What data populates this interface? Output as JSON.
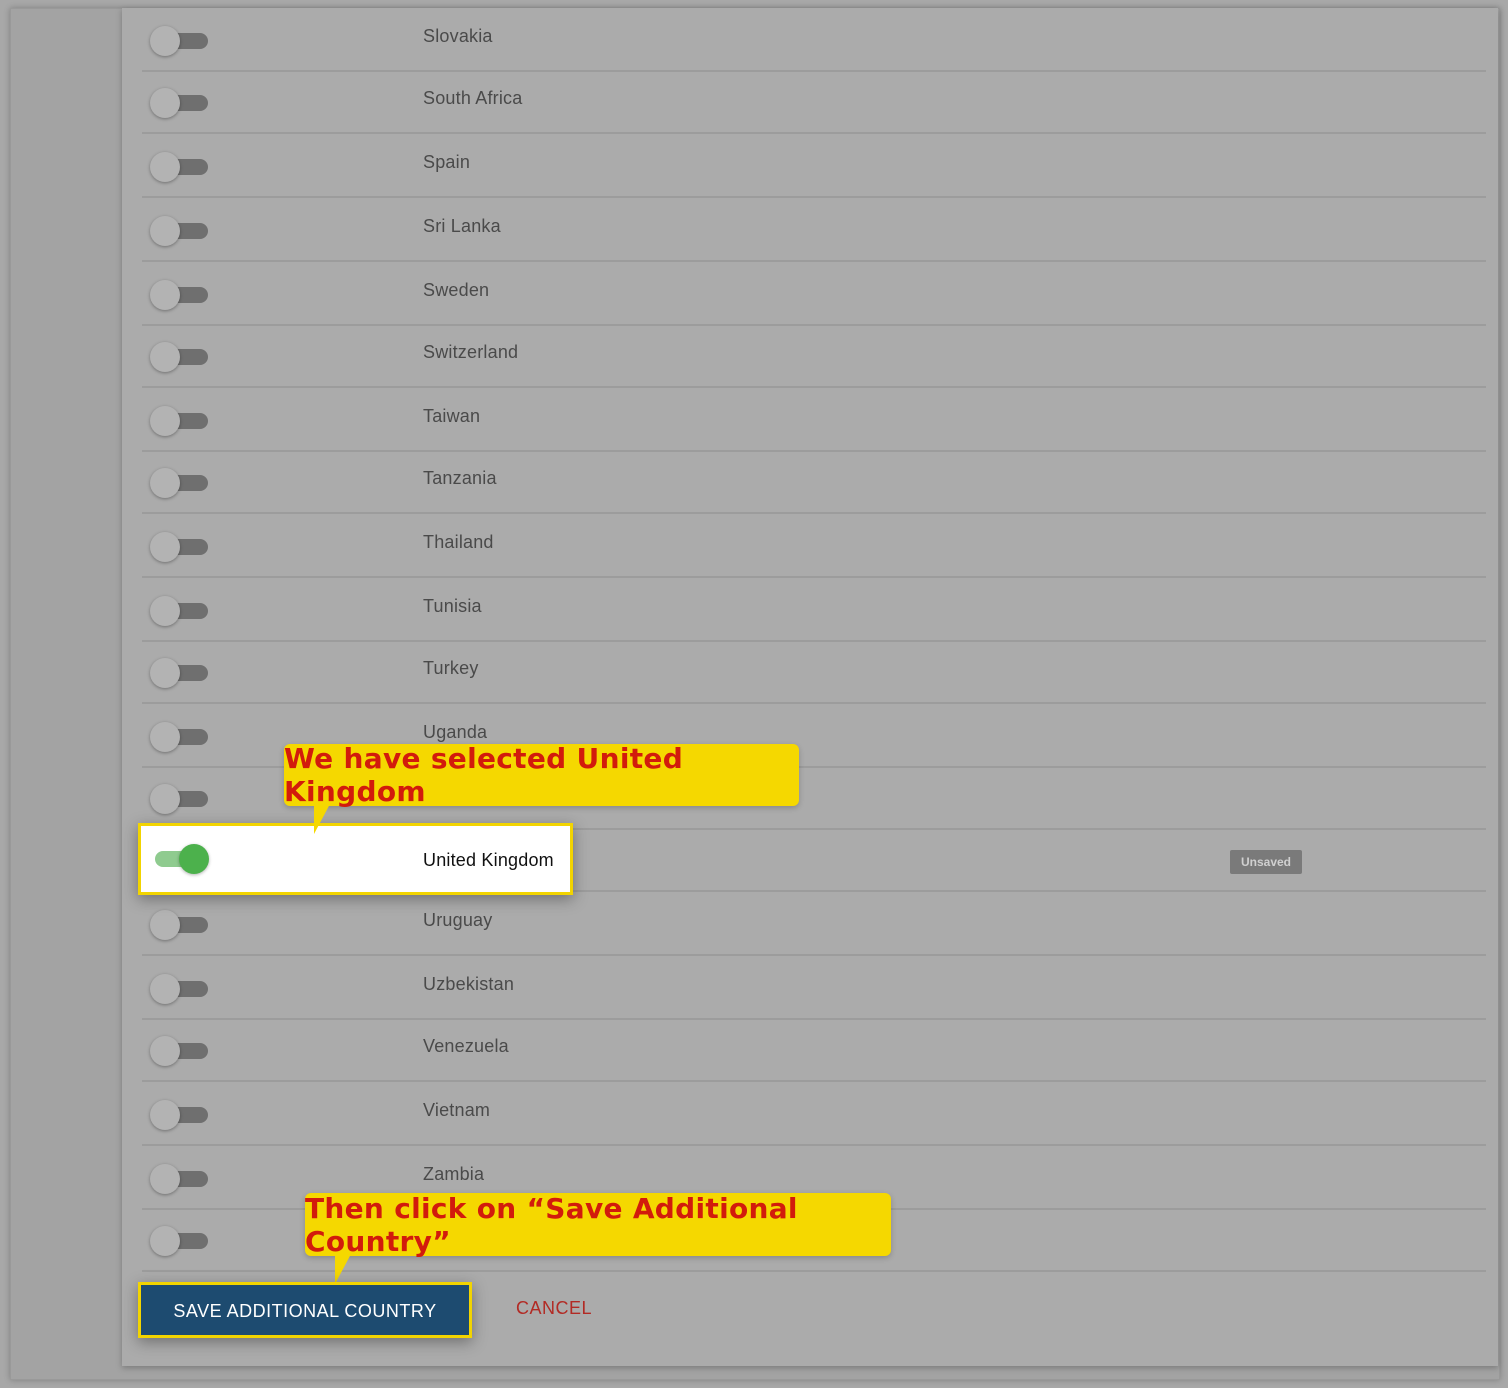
{
  "countries": [
    {
      "name": "Slovakia",
      "enabled": false
    },
    {
      "name": "South Africa",
      "enabled": false
    },
    {
      "name": "Spain",
      "enabled": false
    },
    {
      "name": "Sri Lanka",
      "enabled": false
    },
    {
      "name": "Sweden",
      "enabled": false
    },
    {
      "name": "Switzerland",
      "enabled": false
    },
    {
      "name": "Taiwan",
      "enabled": false
    },
    {
      "name": "Tanzania",
      "enabled": false
    },
    {
      "name": "Thailand",
      "enabled": false
    },
    {
      "name": "Tunisia",
      "enabled": false
    },
    {
      "name": "Turkey",
      "enabled": false
    },
    {
      "name": "Uganda",
      "enabled": false
    },
    {
      "name": "",
      "enabled": false
    },
    {
      "name": "United Kingdom",
      "enabled": true,
      "status": "Unsaved"
    },
    {
      "name": "Uruguay",
      "enabled": false
    },
    {
      "name": "Uzbekistan",
      "enabled": false
    },
    {
      "name": "Venezuela",
      "enabled": false
    },
    {
      "name": "Vietnam",
      "enabled": false
    },
    {
      "name": "Zambia",
      "enabled": false
    },
    {
      "name": "",
      "enabled": false
    }
  ],
  "callouts": {
    "selected": "We have selected United Kingdom",
    "save": "Then click on “Save Additional Country”"
  },
  "actions": {
    "save_label": "SAVE ADDITIONAL COUNTRY",
    "cancel_label": "CANCEL"
  },
  "colors": {
    "primary": "#1d4b70",
    "toggle_on": "#4cb14c",
    "cancel": "#b22a24",
    "callout_bg": "#f5d800",
    "callout_text": "#d21b0c"
  }
}
